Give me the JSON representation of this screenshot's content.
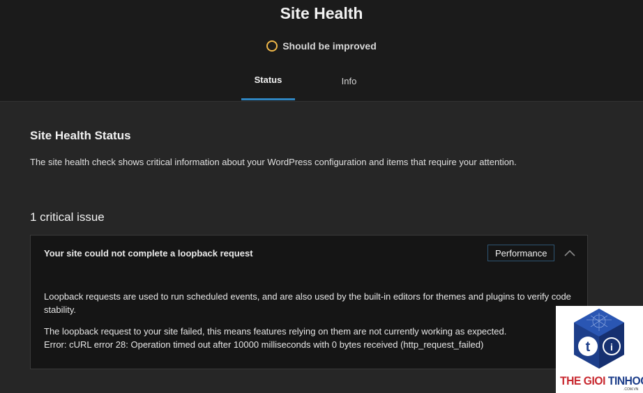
{
  "page": {
    "title": "Site Health",
    "health_status": "Should be improved"
  },
  "tabs": [
    {
      "label": "Status",
      "active": true
    },
    {
      "label": "Info",
      "active": false
    }
  ],
  "main": {
    "heading": "Site Health Status",
    "description": "The site health check shows critical information about your WordPress configuration and items that require your attention.",
    "issue_count": "1 critical issue"
  },
  "issue": {
    "title": "Your site could not complete a loopback request",
    "badge": "Performance",
    "paragraph1": "Loopback requests are used to run scheduled events, and are also used by the built-in editors for themes and plugins to verify code stability.",
    "paragraph2_line1": "The loopback request to your site failed, this means features relying on them are not currently working as expected.",
    "paragraph2_line2": "Error: cURL error 28: Operation timed out after 10000 milliseconds with 0 bytes received (http_request_failed)"
  },
  "watermark": {
    "text_part1": "THE GIOI ",
    "text_part2": "TINHOC",
    "domain": ".COM.VN"
  },
  "colors": {
    "accent_blue": "#2f86c2",
    "status_ring": "#f0b849",
    "badge_border": "#2e5573",
    "logo_blue": "#1d3e8a",
    "logo_red": "#c8282f"
  },
  "icons": {
    "status": "status-ring-icon",
    "collapse": "chevron-up-icon",
    "logo": "logo-icon"
  }
}
